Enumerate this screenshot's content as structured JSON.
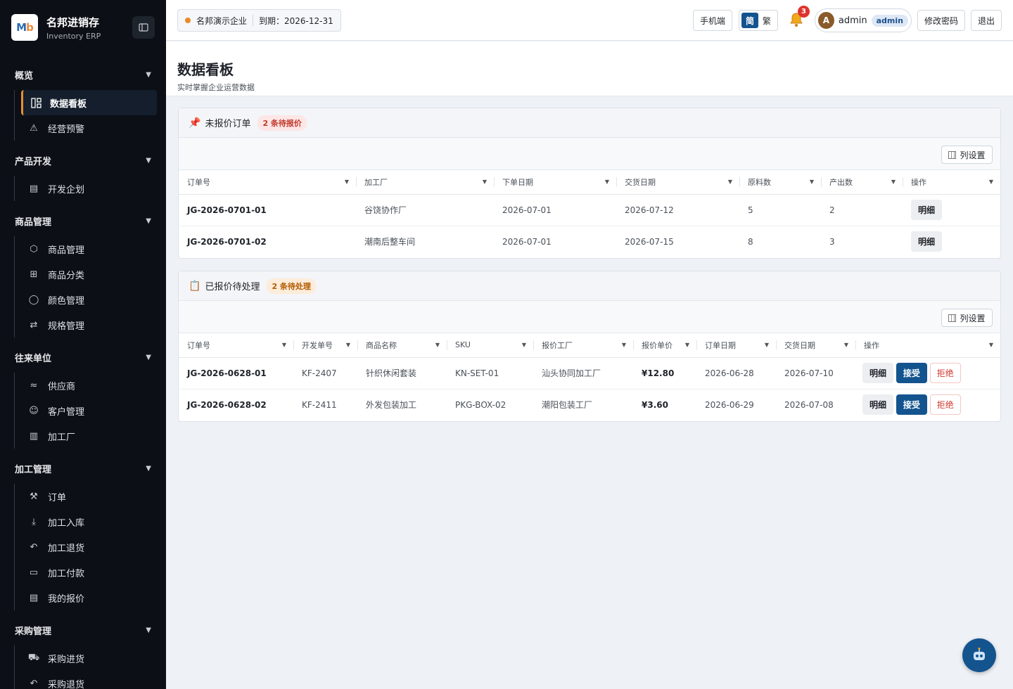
{
  "brand": {
    "logo": "Mb",
    "title": "名邦进销存",
    "subtitle": "Inventory ERP"
  },
  "sidebar": {
    "groups": [
      {
        "label": "概览",
        "items": [
          {
            "label": "数据看板",
            "icon": "dashboard-icon"
          },
          {
            "label": "经营预警",
            "icon": "warning-icon"
          }
        ]
      },
      {
        "label": "产品开发",
        "items": [
          {
            "label": "开发企划",
            "icon": "document-icon"
          }
        ]
      },
      {
        "label": "商品管理",
        "items": [
          {
            "label": "商品管理",
            "icon": "cube-icon"
          },
          {
            "label": "商品分类",
            "icon": "grid-icon"
          },
          {
            "label": "颜色管理",
            "icon": "drop-icon"
          },
          {
            "label": "规格管理",
            "icon": "transfer-icon"
          }
        ]
      },
      {
        "label": "往来单位",
        "items": [
          {
            "label": "供应商",
            "icon": "handshake-icon"
          },
          {
            "label": "客户管理",
            "icon": "users-icon"
          },
          {
            "label": "加工厂",
            "icon": "factory-icon"
          }
        ]
      },
      {
        "label": "加工管理",
        "items": [
          {
            "label": "订单",
            "icon": "hammer-icon"
          },
          {
            "label": "加工入库",
            "icon": "download-icon"
          },
          {
            "label": "加工退货",
            "icon": "undo-icon"
          },
          {
            "label": "加工付款",
            "icon": "card-icon"
          },
          {
            "label": "我的报价",
            "icon": "document-icon"
          }
        ]
      },
      {
        "label": "采购管理",
        "items": [
          {
            "label": "采购进货",
            "icon": "cart-icon"
          },
          {
            "label": "采购退货",
            "icon": "undo-icon"
          }
        ]
      }
    ]
  },
  "topbar": {
    "company": "名邦演示企业",
    "expiry": "到期：2026-12-31",
    "mobile": "手机端",
    "lang_simplified": "简",
    "lang_traditional": "繁",
    "notifications": "3",
    "avatar": "A",
    "username": "admin",
    "role": "admin",
    "change_password": "修改密码",
    "logout": "退出"
  },
  "page": {
    "title": "数据看板",
    "subtitle": "实时掌握企业运营数据"
  },
  "unquoted": {
    "emoji": "📌",
    "title": "未报价订单",
    "badge": "2 条待报价",
    "column_settings": "列设置",
    "columns": [
      "订单号",
      "加工厂",
      "下单日期",
      "交货日期",
      "原料数",
      "产出数",
      "操作"
    ],
    "rows": [
      {
        "order_no": "JG-2026-0701-01",
        "factory": "谷饶协作厂",
        "order_date": "2026-07-01",
        "delivery_date": "2026-07-12",
        "materials": "5",
        "outputs": "2",
        "detail": "明细"
      },
      {
        "order_no": "JG-2026-0701-02",
        "factory": "潮南后整车间",
        "order_date": "2026-07-01",
        "delivery_date": "2026-07-15",
        "materials": "8",
        "outputs": "3",
        "detail": "明细"
      }
    ]
  },
  "quoted": {
    "emoji": "📋",
    "title": "已报价待处理",
    "badge": "2 条待处理",
    "column_settings": "列设置",
    "columns": [
      "订单号",
      "开发单号",
      "商品名称",
      "SKU",
      "报价工厂",
      "报价单价",
      "订单日期",
      "交货日期",
      "操作"
    ],
    "rows": [
      {
        "order_no": "JG-2026-0628-01",
        "dev_no": "KF-2407",
        "product": "针织休闲套装",
        "sku": "KN-SET-01",
        "factory": "汕头协同加工厂",
        "price": "¥12.80",
        "order_date": "2026-06-28",
        "delivery_date": "2026-07-10",
        "detail": "明细",
        "accept": "接受",
        "reject": "拒绝"
      },
      {
        "order_no": "JG-2026-0628-02",
        "dev_no": "KF-2411",
        "product": "外发包装加工",
        "sku": "PKG-BOX-02",
        "factory": "潮阳包装工厂",
        "price": "¥3.60",
        "order_date": "2026-06-29",
        "delivery_date": "2026-07-08",
        "detail": "明细",
        "accept": "接受",
        "reject": "拒绝"
      }
    ]
  },
  "colors": {
    "sidebar_bg": "#0c1016",
    "accent": "#e8902f",
    "primary": "#13548f",
    "danger": "#d03a2f"
  }
}
